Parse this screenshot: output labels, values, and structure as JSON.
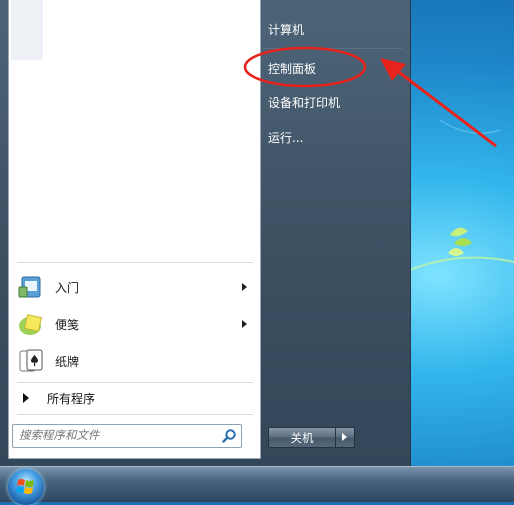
{
  "programs": [
    {
      "label": "入门",
      "has_submenu": true,
      "icon": "getting-started-icon"
    },
    {
      "label": "便笺",
      "has_submenu": true,
      "icon": "sticky-notes-icon"
    },
    {
      "label": "纸牌",
      "has_submenu": false,
      "icon": "solitaire-icon"
    }
  ],
  "all_programs_label": "所有程序",
  "search": {
    "placeholder": "搜索程序和文件",
    "icon": "search-icon"
  },
  "right_pane": {
    "computer_label": "计算机",
    "control_panel_label": "控制面板",
    "devices_label": "设备和打印机",
    "run_label": "运行..."
  },
  "shutdown": {
    "label": "关机",
    "more_icon": "chevron-right-icon"
  },
  "annotation": {
    "color": "#e8231b",
    "highlighted_item": "控制面板"
  },
  "colors": {
    "menu_dark": "#3b4e60",
    "wallpaper": "#1d86c8"
  }
}
